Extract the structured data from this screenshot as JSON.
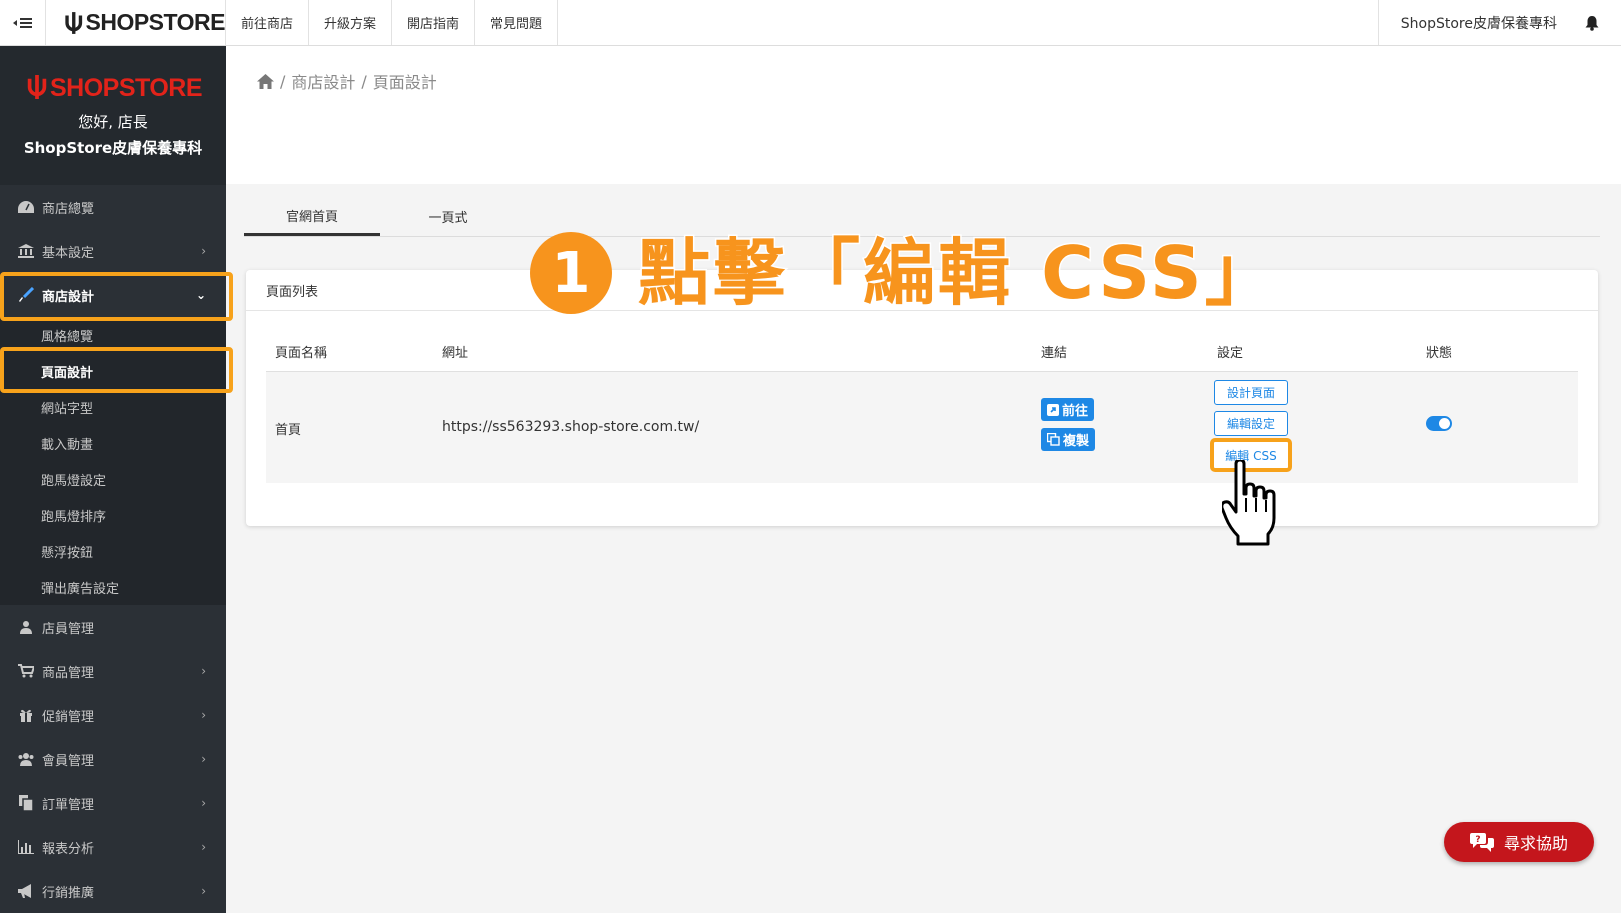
{
  "topbar": {
    "logo": "SHOPSTORE",
    "nav": [
      "前往商店",
      "升級方案",
      "開店指南",
      "常見問題"
    ],
    "store_name": "ShopStore皮膚保養專科"
  },
  "sidebar": {
    "logo": "SHOPSTORE",
    "greeting": "您好, 店長",
    "shop_name": "ShopStore皮膚保養專科",
    "items": [
      {
        "label": "商店總覽",
        "icon": "dashboard-icon"
      },
      {
        "label": "基本設定",
        "icon": "bank-icon"
      },
      {
        "label": "商店設計",
        "icon": "brush-icon"
      },
      {
        "label": "店員管理",
        "icon": "user-secret-icon"
      },
      {
        "label": "商品管理",
        "icon": "cart-icon"
      },
      {
        "label": "促銷管理",
        "icon": "gift-icon"
      },
      {
        "label": "會員管理",
        "icon": "users-icon"
      },
      {
        "label": "訂單管理",
        "icon": "copy-icon"
      },
      {
        "label": "報表分析",
        "icon": "bar-chart-icon"
      },
      {
        "label": "行銷推廣",
        "icon": "bullhorn-icon"
      }
    ],
    "submenu": [
      "風格總覽",
      "頁面設計",
      "網站字型",
      "載入動畫",
      "跑馬燈設定",
      "跑馬燈排序",
      "懸浮按鈕",
      "彈出廣告設定"
    ]
  },
  "breadcrumb": {
    "level1": "商店設計",
    "level2": "頁面設計",
    "sep": "/"
  },
  "tabs": [
    "官網首頁",
    "一頁式"
  ],
  "card": {
    "title": "頁面列表",
    "headers": [
      "頁面名稱",
      "網址",
      "連結",
      "設定",
      "狀態"
    ],
    "row": {
      "name": "首頁",
      "url": "https://ss563293.shop-store.com.tw/",
      "link_buttons": [
        "前往",
        "複製"
      ],
      "setting_buttons": [
        "設計頁面",
        "編輯設定",
        "編輯 CSS"
      ],
      "status_on": true
    }
  },
  "annotation": {
    "number": "1",
    "text": "點擊「編輯 CSS」"
  },
  "help_button": "尋求協助",
  "colors": {
    "accent": "#f7941d",
    "primary": "#1e88e5",
    "sidebar": "#2b3036",
    "help": "#c4161c",
    "logo_red": "#e2231a"
  }
}
